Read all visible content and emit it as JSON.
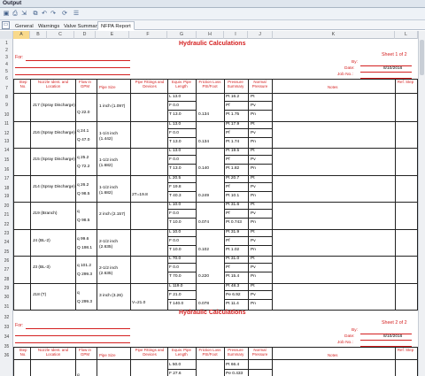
{
  "window": {
    "title": "Output"
  },
  "toolbar": {
    "icons": [
      "save-icon",
      "print-icon",
      "export-icon",
      "copy-icon",
      "undo-icon",
      "redo-icon",
      "refresh-icon",
      "layout-icon"
    ]
  },
  "tabs": [
    {
      "label": "General"
    },
    {
      "label": "Warnings"
    },
    {
      "label": "Valve Summary"
    },
    {
      "label": "NFPA Report",
      "active": true
    }
  ],
  "columns": [
    "A",
    "B",
    "C",
    "D",
    "E",
    "F",
    "G",
    "H",
    "I",
    "J",
    "K",
    "L"
  ],
  "rows": [
    "1",
    "2",
    "3",
    "4",
    "5",
    "6",
    "7",
    "8",
    "9",
    "10",
    "11",
    "12",
    "13",
    "14",
    "15",
    "16",
    "17",
    "18",
    "19",
    "20",
    "21",
    "22",
    "23",
    "24",
    "25",
    "26",
    "27",
    "28",
    "29",
    "30",
    "31",
    "32",
    "33",
    "34",
    "35",
    "36"
  ],
  "sheet1": {
    "title": "Hydraulic Calculations",
    "for_label": "For:",
    "sheet_label": "Sheet 1 of 2",
    "by_label": "By:",
    "date_label": "Date:",
    "date_value": "8/10/2016",
    "job_label": "Job No.:"
  },
  "sheet2": {
    "title": "Hydraulic Calculations",
    "for_label": "For:",
    "sheet_label": "Sheet 2 of 2",
    "by_label": "By:",
    "date_label": "Date:",
    "date_value": "8/10/2016",
    "job_label": "Job No.:"
  },
  "headers": {
    "step_no": "Step No.",
    "nozzle": "Nozzle Ident. and Location",
    "flow": "Flow in GPM",
    "pipe_size": "Pipe Size",
    "fittings": "Pipe Fittings and Devices",
    "equiv": "Equiv. Pipe Length",
    "friction": "Friction Loss PSI/Foot",
    "pressure": "Pressure Summary",
    "normal": "Normal Pressure",
    "notes": "Notes",
    "ref": "Ref. Step"
  },
  "steps": [
    {
      "nozzle": "J17 (Spray Discharge)",
      "q": "",
      "flow": "Q 22.0",
      "pipe": "1 inch (1.097)",
      "fit": "",
      "L": "L 13.0",
      "F": "F 0.0",
      "T": "T 13.0",
      "fr": "0.134",
      "pt": "Pt 16.2",
      "pf": "Pf",
      "pe": "Pe",
      "pv": "Pt 1.75"
    },
    {
      "nozzle": "J16 (Spray Discharge)",
      "q": "q 24.1",
      "flow": "Q 47.0",
      "pipe": "1-1/4 inch (1.442)",
      "fit": "",
      "L": "L 13.0",
      "F": "F 0.0",
      "T": "T 13.0",
      "fr": "0.134",
      "pt": "Pt 17.9",
      "pf": "Pf",
      "pe": "Pe",
      "pv": "Pt 1.74"
    },
    {
      "nozzle": "J15 (Spray Discharge)",
      "q": "q 25.2",
      "flow": "Q 72.2",
      "pipe": "1-1/2 inch (1.682)",
      "fit": "",
      "L": "L 13.0",
      "F": "F 0.0",
      "T": "T 13.0",
      "fr": "0.140",
      "pt": "Pt 19.5",
      "pf": "Pf",
      "pe": "Pe",
      "pv": "Pt 1.82"
    },
    {
      "nozzle": "J14 (Spray Discharge)",
      "q": "q 26.2",
      "flow": "Q 98.5",
      "pipe": "1-1/2 inch (1.682)",
      "fit": "2T=19.8",
      "L": "L 20.5",
      "F": "F 19.8",
      "T": "T 40.3",
      "fr": "0.249",
      "pt": "Pt 20.7",
      "pf": "Pf",
      "pe": "Pe",
      "pv": "Pt 10.1"
    },
    {
      "nozzle": "J19 (Branch)",
      "q": "q",
      "flow": "Q 98.5",
      "pipe": "2 inch (2.157)",
      "fit": "",
      "L": "L 10.0",
      "F": "F 0.0",
      "T": "T 10.0",
      "fr": "0.074",
      "pt": "Pt 31.6",
      "pf": "Pf",
      "pe": "Pe",
      "pv": "Pt 0.743"
    },
    {
      "nozzle": "J4 (BL-2)",
      "q": "q 99.6",
      "flow": "Q 198.1",
      "pipe": "2-1/2 inch (2.635)",
      "fit": "",
      "L": "L 10.0",
      "F": "F 0.0",
      "T": "T 10.0",
      "fr": "0.102",
      "pt": "Pt 31.9",
      "pf": "Pf",
      "pe": "Pe",
      "pv": "Pt 1.02"
    },
    {
      "nozzle": "J3 (BL-3)",
      "q": "q 101.2",
      "flow": "Q 299.3",
      "pipe": "2-1/2 inch (2.635)",
      "fit": "",
      "L": "L 70.0",
      "F": "F 0.0",
      "T": "T 70.0",
      "fr": "0.220",
      "pt": "Pt 31.0",
      "pf": "Pf",
      "pe": "Pe",
      "pv": "Pt 15.4"
    },
    {
      "nozzle": "J18 (T)",
      "q": "q",
      "flow": "Q 299.3",
      "pipe": "3 inch (3.26)",
      "fit": "V=21.0",
      "L": "L 119.0",
      "F": "F 21.0",
      "T": "T 140.0",
      "fr": "0.078",
      "pt": "Pt 48.3",
      "pf": "Pe 6.92",
      "pe": "Pe",
      "pv": "Pt 11.4"
    }
  ],
  "step9": {
    "nozzle": "",
    "q": "q",
    "L": "L 50.0",
    "F": "F 27.6",
    "pt": "Pt 66.4",
    "pe": "Pe 0.433"
  }
}
